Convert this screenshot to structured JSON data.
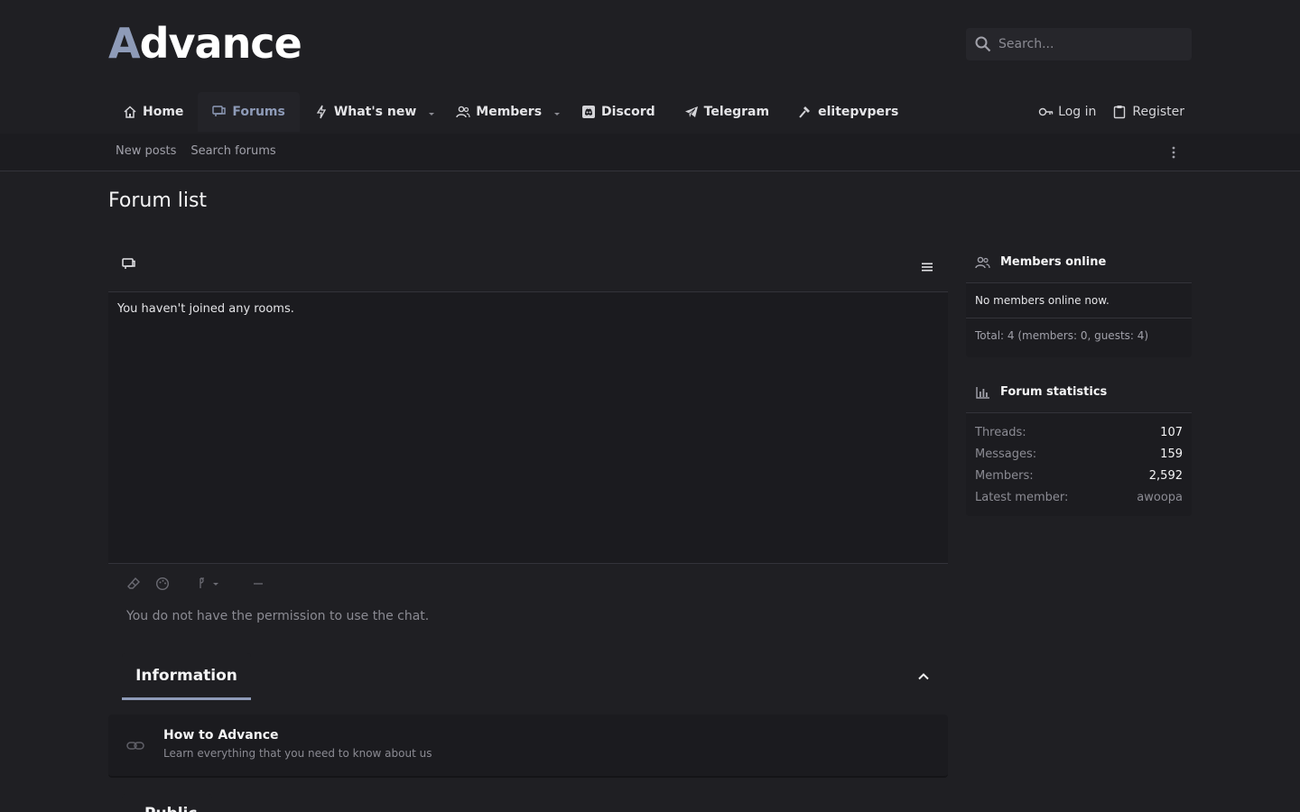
{
  "header": {
    "logo_first": "A",
    "logo_rest": "dvance",
    "search_placeholder": "Search..."
  },
  "nav": {
    "items": [
      {
        "label": "Home",
        "icon": "home-icon"
      },
      {
        "label": "Forums",
        "icon": "forums-icon"
      },
      {
        "label": "What's new",
        "icon": "bolt-icon"
      },
      {
        "label": "Members",
        "icon": "users-icon"
      },
      {
        "label": "Discord",
        "icon": "discord-icon"
      },
      {
        "label": "Telegram",
        "icon": "telegram-icon"
      },
      {
        "label": "elitepvpers",
        "icon": "hammer-icon"
      }
    ],
    "login": "Log in",
    "register": "Register"
  },
  "subnav": {
    "links": [
      "New posts",
      "Search forums"
    ]
  },
  "page": {
    "title": "Forum list"
  },
  "chat": {
    "empty_message": "You haven't joined any rooms.",
    "permission_message": "You do not have the permission to use the chat."
  },
  "information": {
    "tab_label": "Information",
    "forum_title": "How to Advance",
    "forum_desc": "Learn everything that you need to know about us"
  },
  "next_section": {
    "tab_label": "Public"
  },
  "sidebar": {
    "members_online": {
      "title": "Members online",
      "status": "No members online now.",
      "total": "Total: 4 (members: 0, guests: 4)"
    },
    "forum_statistics": {
      "title": "Forum statistics",
      "stats": [
        {
          "key": "Threads:",
          "value": "107"
        },
        {
          "key": "Messages:",
          "value": "159"
        },
        {
          "key": "Members:",
          "value": "2,592"
        },
        {
          "key": "Latest member:",
          "value": "awoopa"
        }
      ]
    }
  },
  "colors": {
    "accent": "#8e9bb8",
    "background": "#1f1f23"
  }
}
